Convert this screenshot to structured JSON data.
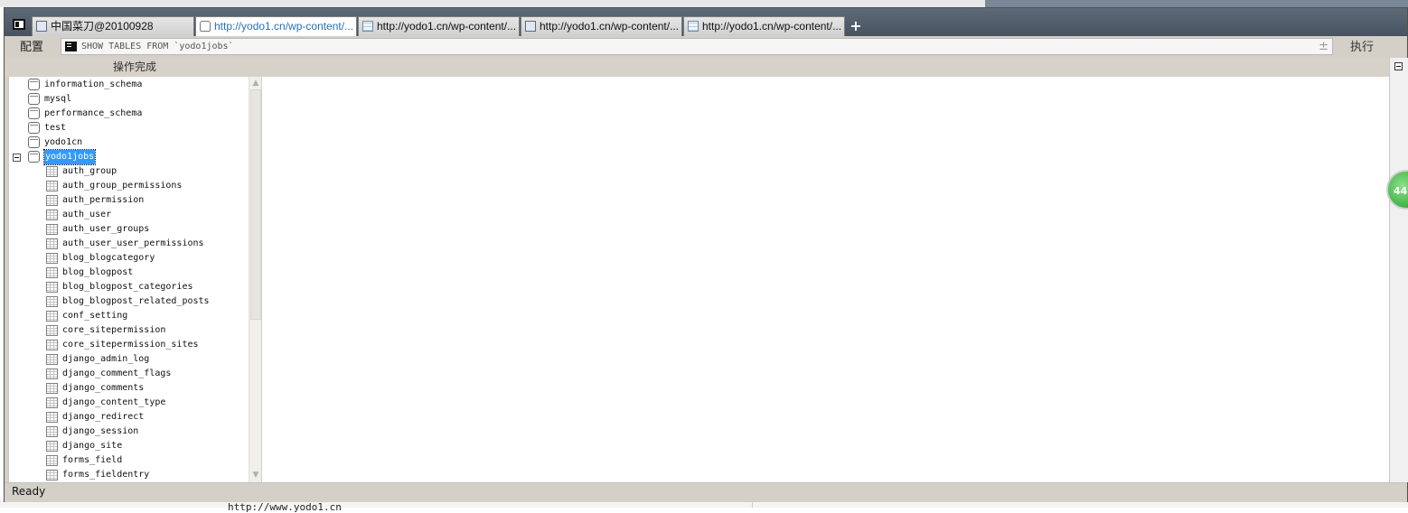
{
  "tabs": [
    {
      "label": "中国菜刀@20100928",
      "icon": "window-icon",
      "active": false
    },
    {
      "label": "http://yodo1.cn/wp-content/...",
      "icon": "database-icon",
      "active": true
    },
    {
      "label": "http://yodo1.cn/wp-content/...",
      "icon": "table-icon",
      "active": false
    },
    {
      "label": "http://yodo1.cn/wp-content/...",
      "icon": "file-icon",
      "active": false
    },
    {
      "label": "http://yodo1.cn/wp-content/...",
      "icon": "table-icon",
      "active": false
    }
  ],
  "new_tab_label": "+",
  "toolbar": {
    "config_label": "配置",
    "sql_query": "SHOW TABLES FROM `yodo1jobs`",
    "expand_label": "±",
    "execute_label": "执行"
  },
  "message": "操作完成",
  "badge_text": "44",
  "tree": {
    "databases": [
      "information_schema",
      "mysql",
      "performance_schema",
      "test",
      "yodo1cn",
      "yodo1jobs"
    ],
    "selected_database": "yodo1jobs",
    "tables": [
      "auth_group",
      "auth_group_permissions",
      "auth_permission",
      "auth_user",
      "auth_user_groups",
      "auth_user_user_permissions",
      "blog_blogcategory",
      "blog_blogpost",
      "blog_blogpost_categories",
      "blog_blogpost_related_posts",
      "conf_setting",
      "core_sitepermission",
      "core_sitepermission_sites",
      "django_admin_log",
      "django_comment_flags",
      "django_comments",
      "django_content_type",
      "django_redirect",
      "django_session",
      "django_site",
      "forms_field",
      "forms_fieldentry"
    ]
  },
  "status": "Ready",
  "background_text": "http://www.yodo1.cn"
}
